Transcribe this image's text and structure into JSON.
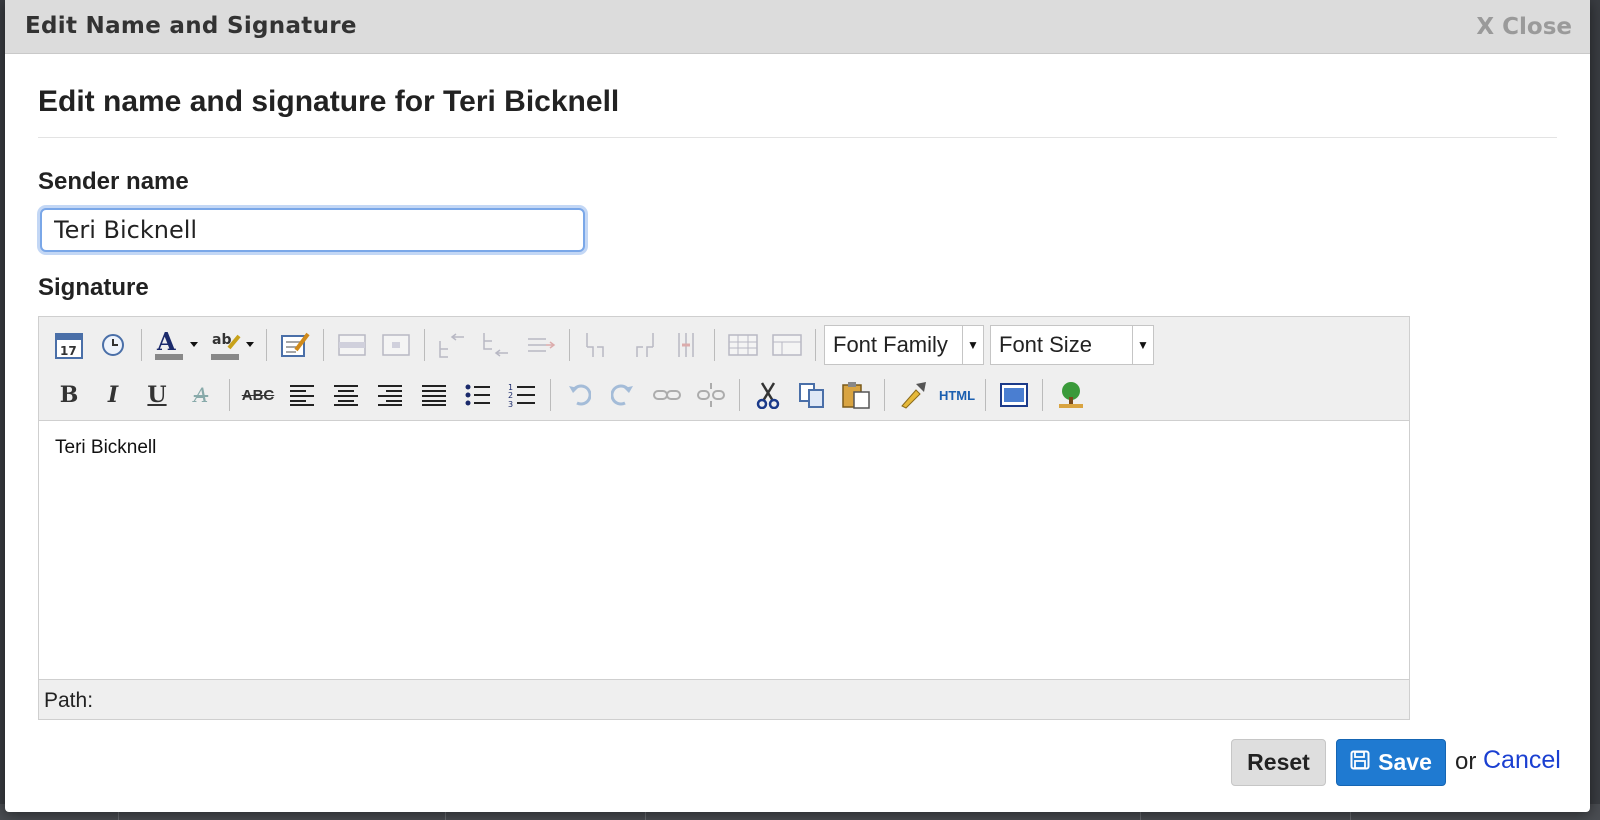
{
  "dialog": {
    "title": "Edit Name and Signature",
    "close_label": "X Close",
    "heading": "Edit name and signature for Teri Bicknell"
  },
  "sender": {
    "label": "Sender name",
    "value": "Teri Bicknell"
  },
  "signature": {
    "label": "Signature",
    "content": "Teri Bicknell",
    "path_label": "Path:",
    "font_family_label": "Font Family",
    "font_size_label": "Font Size",
    "toolbar_row1": [
      "insert-date-icon",
      "insert-time-icon",
      "font-color-icon",
      "highlight-color-icon",
      "edit-table-icon",
      "row-properties-icon",
      "cell-properties-icon",
      "insert-row-before-icon",
      "insert-row-after-icon",
      "delete-row-icon",
      "insert-col-before-icon",
      "insert-col-after-icon",
      "delete-col-icon",
      "split-cells-icon",
      "merge-cells-icon"
    ],
    "toolbar_row2": [
      "bold-icon",
      "italic-icon",
      "underline-icon",
      "strikethrough-style-icon",
      "strikethrough-icon",
      "align-left-icon",
      "align-center-icon",
      "align-right-icon",
      "align-justify-icon",
      "bullet-list-icon",
      "numbered-list-icon",
      "undo-icon",
      "redo-icon",
      "link-icon",
      "unlink-icon",
      "cut-icon",
      "copy-icon",
      "paste-icon",
      "cleanup-icon",
      "html-source-icon",
      "preview-icon",
      "insert-image-icon"
    ]
  },
  "actions": {
    "reset_label": "Reset",
    "save_label": "Save",
    "or_text": "or",
    "cancel_label": "Cancel"
  },
  "colors": {
    "accent": "#1f7ad1",
    "link": "#1a3fd1",
    "focus_ring": "#7aa7e8",
    "titlebar": "#dcdcdc"
  }
}
